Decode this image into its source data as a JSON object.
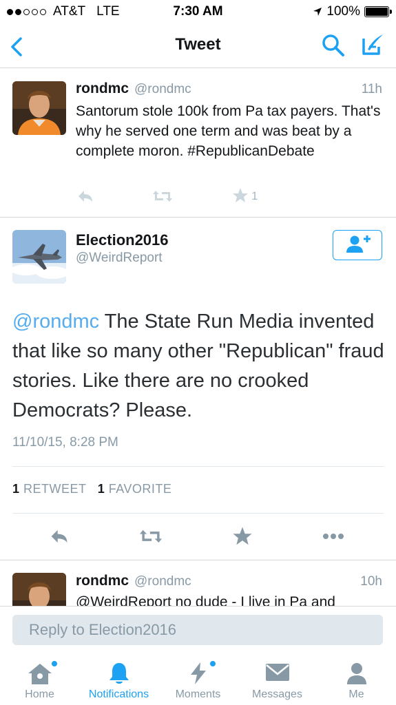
{
  "status_bar": {
    "carrier": "AT&T",
    "network": "LTE",
    "time": "7:30 AM",
    "battery": "100%",
    "battery_level": 1.0
  },
  "nav": {
    "title": "Tweet"
  },
  "reply_tweet": {
    "name": "rondmc",
    "handle": "@rondmc",
    "time": "11h",
    "text": "Santorum stole 100k from Pa tax payers. That's why he served one term and was beat by a complete moron. #RepublicanDebate",
    "favorite_count": "1"
  },
  "main_tweet": {
    "name": "Election2016",
    "handle": "@WeirdReport",
    "mention": "@rondmc",
    "text": " The State Run Media invented that like so many other \"Republican\" fraud stories. Like there are no crooked Democrats? Please.",
    "date": "11/10/15, 8:28 PM",
    "retweet_count": "1",
    "retweet_label": "RETWEET",
    "favorite_count": "1",
    "favorite_label": "FAVORITE"
  },
  "next_tweet": {
    "name": "rondmc",
    "handle": "@rondmc",
    "time": "10h",
    "text": "@WeirdReport no dude - I live in Pa and"
  },
  "reply": {
    "placeholder": "Reply to Election2016"
  },
  "tabs": [
    {
      "label": "Home",
      "icon": "home-icon"
    },
    {
      "label": "Notifications",
      "icon": "bell-icon"
    },
    {
      "label": "Moments",
      "icon": "lightning-icon"
    },
    {
      "label": "Messages",
      "icon": "envelope-icon"
    },
    {
      "label": "Me",
      "icon": "person-icon"
    }
  ],
  "colors": {
    "accent": "#1da1f2",
    "mention": "#55acee",
    "muted": "#8899a6"
  }
}
